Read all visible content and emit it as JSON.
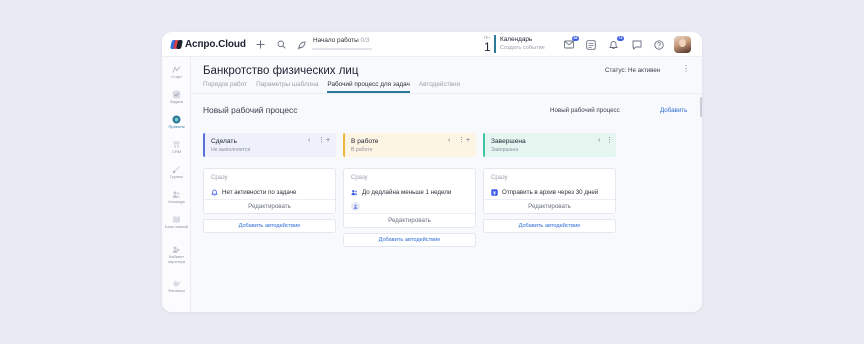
{
  "app": {
    "brand": "Аспро.Cloud"
  },
  "topbar": {
    "start_work_label": "Начало работы",
    "start_work_progress": "0/3",
    "start_work_progress_fraction": 0,
    "day_label": "Пн",
    "day_number": "1",
    "calendar_title": "Календарь",
    "calendar_sub": "Создать событие",
    "mail_badge": "38",
    "notif_badge": "74"
  },
  "sidebar": {
    "items": [
      {
        "label": "Старт"
      },
      {
        "label": "Задачи"
      },
      {
        "label": "Проекты"
      },
      {
        "label": "CRM"
      },
      {
        "label": "Группы"
      },
      {
        "label": "Команда"
      },
      {
        "label": "База знаний"
      },
      {
        "label": "Кабинет партнера"
      },
      {
        "label": "Финансы"
      }
    ]
  },
  "page": {
    "title": "Банкротство физических лиц",
    "status_label": "Статус:",
    "status_value": "Не активен",
    "tabs": [
      {
        "label": "Порядок работ"
      },
      {
        "label": "Параметры шаблона"
      },
      {
        "label": "Рабочий процесс для задач"
      },
      {
        "label": "Автодействия"
      }
    ],
    "process_title": "Новый рабочий процесс",
    "process_select": "Новый рабочий процесс",
    "add_label": "Добавить"
  },
  "columns": [
    {
      "name": "Сделать",
      "sub": "Не выполняется",
      "accent": "#5b6fd8",
      "bg": "#eef0fb",
      "card_when": "Сразу",
      "card_condition": "Нет активности по задаче",
      "card_icon": "bell-icon",
      "edit_label": "Редактировать",
      "add_auto_label": "Добавить автодействие"
    },
    {
      "name": "В работе",
      "sub": "В работе",
      "accent": "#f2b33d",
      "bg": "#fdf5e4",
      "card_when": "Сразу",
      "card_condition": "До дедлайна меньше 1 недели",
      "card_icon": "users-icon",
      "edit_label": "Редактировать",
      "add_auto_label": "Добавить автодействие"
    },
    {
      "name": "Завершена",
      "sub": "Завершена",
      "accent": "#3fc5a3",
      "bg": "#e5f6f1",
      "card_when": "Сразу",
      "card_condition": "Отправить в архив через 30 дней",
      "card_icon": "archive-icon",
      "edit_label": "Редактировать",
      "add_auto_label": "Добавить автодействие"
    }
  ]
}
